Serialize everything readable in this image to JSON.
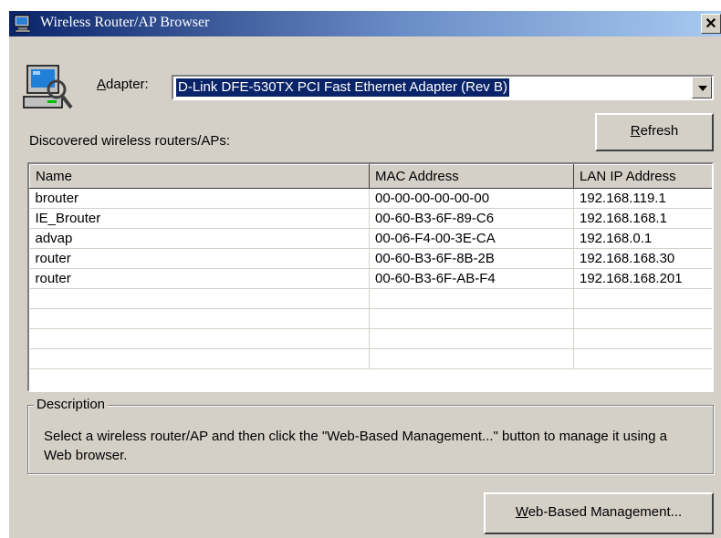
{
  "window": {
    "title": "Wireless Router/AP Browser",
    "close_label": "✕"
  },
  "adapter": {
    "label_mnemonic": "A",
    "label_rest": "dapter:",
    "selected": "D-Link DFE-530TX PCI Fast Ethernet Adapter (Rev B)"
  },
  "refresh_button": {
    "mnemonic": "R",
    "rest": "efresh"
  },
  "discovered_label": "Discovered wireless routers/APs:",
  "table": {
    "columns": [
      "Name",
      "MAC Address",
      "LAN IP Address"
    ],
    "rows": [
      [
        "brouter",
        "00-00-00-00-00-00",
        "192.168.119.1"
      ],
      [
        "IE_Brouter",
        "00-60-B3-6F-89-C6",
        "192.168.168.1"
      ],
      [
        "advap",
        "00-06-F4-00-3E-CA",
        "192.168.0.1"
      ],
      [
        "router",
        "00-60-B3-6F-8B-2B",
        "192.168.168.30"
      ],
      [
        "router",
        "00-60-B3-6F-AB-F4",
        "192.168.168.201"
      ]
    ],
    "empty_rows": 4
  },
  "description": {
    "legend": "Description",
    "text": "Select a wireless router/AP and then click the \"Web-Based Management...\" button to manage it using a Web browser."
  },
  "web_button": {
    "mnemonic": "W",
    "rest": "eb-Based Management..."
  },
  "colors": {
    "title_gradient_start": "#0a246a",
    "title_gradient_end": "#a6caf0",
    "dialog_face": "#d4d0c8",
    "selection": "#0a246a"
  }
}
